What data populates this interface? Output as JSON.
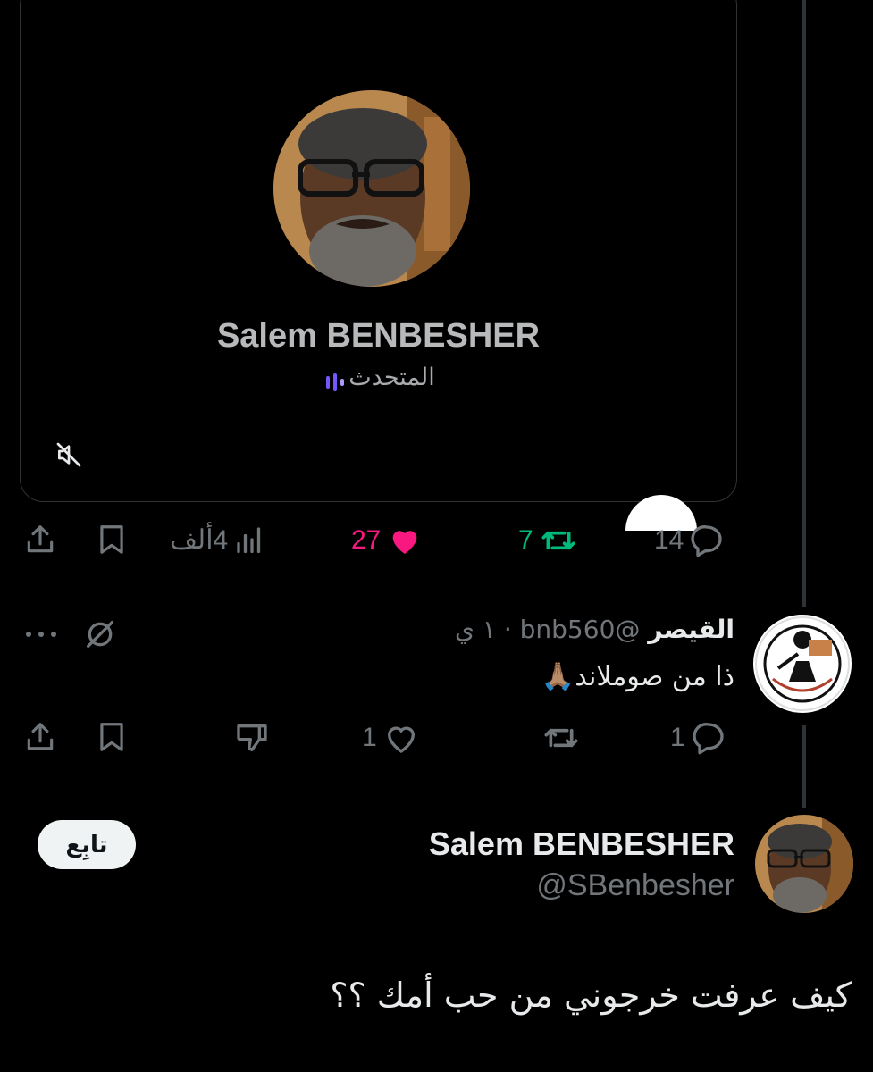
{
  "media_card": {
    "speaker_name": "Salem BENBESHER",
    "speaker_role": "المتحدث"
  },
  "main_post_actions": {
    "replies": "14",
    "reposts": "7",
    "likes": "27",
    "views": "4ألف"
  },
  "reply": {
    "author_name": "القيصر",
    "handle": "@bnb560",
    "separator": "·",
    "time": "١ ي",
    "text": "ذا من صوملاند",
    "emoji": "🙏🏽",
    "actions": {
      "replies": "1",
      "likes": "1"
    }
  },
  "focused_post": {
    "author_name": "Salem BENBESHER",
    "handle": "@SBenbesher",
    "follow_label": "تابِع",
    "text": "كيف عرفت خرجوني من حب أمك ؟؟"
  },
  "colors": {
    "background": "#000000",
    "like_active": "#f91880",
    "repost_active": "#00ba7c",
    "muted": "#71767b",
    "speaking_bars": "#7856ff"
  },
  "icons": [
    "share-icon",
    "bookmark-icon",
    "views-icon",
    "heart-icon",
    "repost-icon",
    "reply-icon",
    "more-icon",
    "grok-icon",
    "dislike-icon",
    "mute-icon",
    "speaking-bars-icon"
  ]
}
